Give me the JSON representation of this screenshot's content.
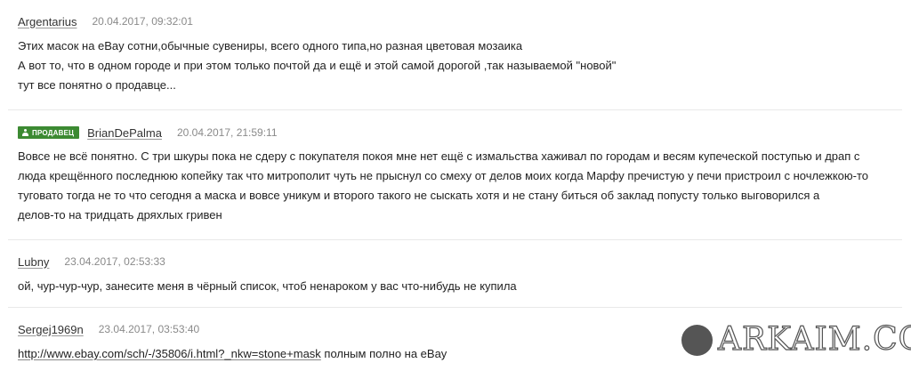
{
  "comments": [
    {
      "author": "Argentarius",
      "date": "20.04.2017, 09:32:01",
      "lines": [
        "Этих масок на eBay сотни,обычные сувениры, всего одного типа,но разная цветовая мозаика",
        "А вот то, что в одном городе и при этом только почтой да и ещё и этой самой дорогой ,так называемой \"новой\"",
        "тут все понятно о продавце..."
      ]
    },
    {
      "badge": "ПРОДАВЕЦ",
      "author": "BrianDePalma",
      "date": "20.04.2017, 21:59:11",
      "lines": [
        "Вовсе не всё понятно. С три шкуры пока не сдеру с покупателя покоя мне нет ещё с измальства хаживал по городам и весям купеческой поступью и драп с",
        "люда крещённого последнюю копейку так что митрополит чуть не прыснул со смеху от делов моих когда Марфу пречистую у печи пристроил с ночлежкою-то",
        "туговато тогда не то что сегодня а маска и вовсе уникум и второго такого не сыскать хотя и не стану биться об заклад попусту только выговорился а",
        "делов-то на тридцать дряхлых гривен"
      ]
    },
    {
      "author": "Lubny",
      "date": "23.04.2017, 02:53:33",
      "lines": [
        "ой, чур-чур-чур, занесите меня в чёрный список, чтоб ненароком у вас что-нибудь не купила"
      ]
    },
    {
      "author": "Sergej1969n",
      "date": "23.04.2017, 03:53:40",
      "link": "http://www.ebay.com/sch/-/35806/i.html?_nkw=stone+mask",
      "link_suffix": " полным полно на eBay"
    }
  ],
  "watermark": {
    "text": "ARKAIM.CO"
  },
  "colors": {
    "badge_bg": "#3c8a32",
    "divider": "#e9e9e9",
    "date": "#8a8a8a"
  }
}
